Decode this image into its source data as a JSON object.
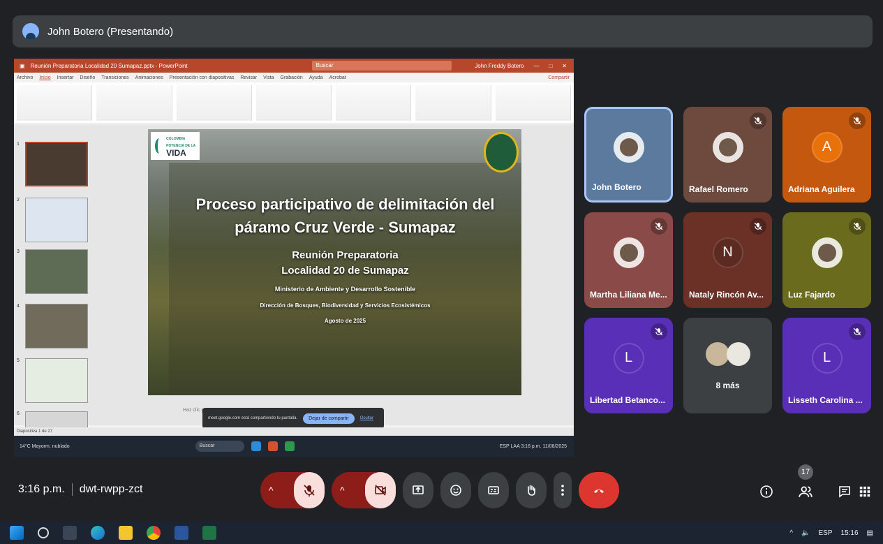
{
  "meet": {
    "presenter": "John Botero (Presentando)",
    "time": "3:16 p.m.",
    "meeting_code": "dwt-rwpp-zct",
    "participant_count": "17",
    "more_label": "8 más"
  },
  "participants": [
    {
      "name": "John Botero",
      "initial": "",
      "muted": false,
      "bg": "#5b7a9d"
    },
    {
      "name": "Rafael Romero",
      "initial": "",
      "muted": true,
      "bg": "#6e4a3e"
    },
    {
      "name": "Adriana Aguilera",
      "initial": "A",
      "muted": true,
      "bg": "#c4580f"
    },
    {
      "name": "Martha Liliana Me...",
      "initial": "",
      "muted": true,
      "bg": "#8a4a48"
    },
    {
      "name": "Nataly Rincón Av...",
      "initial": "N",
      "muted": true,
      "bg": "#6b3026"
    },
    {
      "name": "Luz Fajardo",
      "initial": "",
      "muted": true,
      "bg": "#6b6b1e"
    },
    {
      "name": "Libertad Betanco...",
      "initial": "L",
      "muted": true,
      "bg": "#5a2fb8"
    },
    {
      "name": "",
      "initial": "",
      "muted": false,
      "bg": "#3c4043"
    },
    {
      "name": "Lisseth Carolina ...",
      "initial": "L",
      "muted": true,
      "bg": "#5a2fb8"
    }
  ],
  "powerpoint": {
    "title": "Reunión Preparatoria Localidad 20 Sumapaz.pptx - PowerPoint",
    "search": "Buscar",
    "user": "John Freddy Botero",
    "tabs": [
      "Archivo",
      "Inicio",
      "Insertar",
      "Diseño",
      "Transiciones",
      "Animaciones",
      "Presentación con diapositivas",
      "Revisar",
      "Vista",
      "Grabación",
      "Ayuda",
      "Acrobat"
    ],
    "share_label": "Compartir",
    "notes_placeholder": "Haz clic para agregar notas",
    "status": "Diapositiva 1 de 27",
    "share_notice": "meet.google.com está compartiendo tu pantalla.",
    "stop_share": "Dejar de compartir",
    "hide": "Ocultar",
    "taskbar_search": "Buscar",
    "clock_time": "3:16 p.m.",
    "clock_date": "11/08/2025",
    "weather_temp": "14°C",
    "weather_desc": "Mayorm. nublado",
    "lang_in": "ESP LAA"
  },
  "slide": {
    "logo_small": "COLOMBIA POTENCIA DE LA",
    "logo": "VIDA",
    "title1": "Proceso participativo de delimitación del",
    "title2": "páramo Cruz Verde - Sumapaz",
    "subtitle1": "Reunión Preparatoria",
    "subtitle2": "Localidad 20 de Sumapaz",
    "org1": "Ministerio de Ambiente y Desarrollo Sostenible",
    "org2": "Dirección de Bosques, Biodiversidad y Servicios Ecosistémicos",
    "date": "Agosto de 2025"
  },
  "windows_taskbar": {
    "lang": "ESP",
    "time": "15:16"
  }
}
